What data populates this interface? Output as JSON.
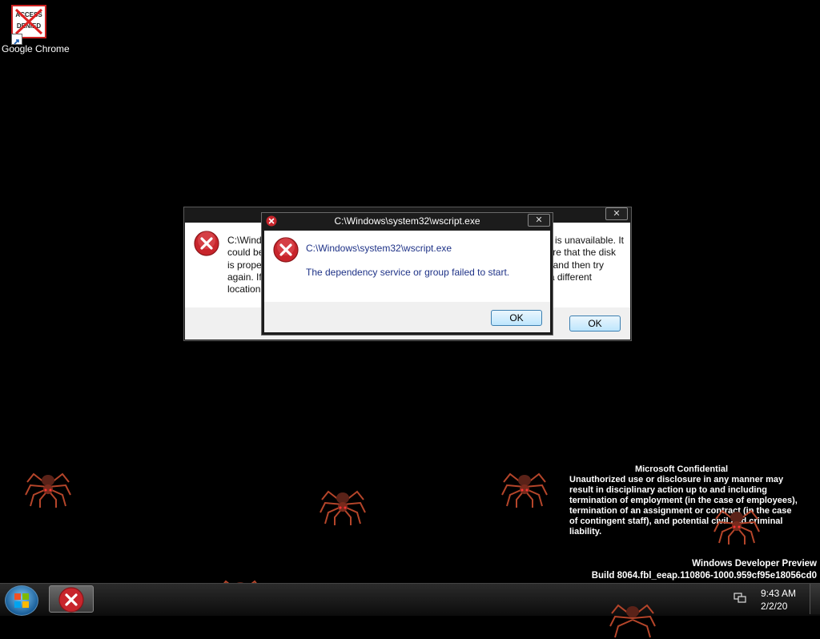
{
  "desktop": {
    "icon_badge_line1": "ACCESS",
    "icon_badge_line2": "DENIED",
    "icon_label": "Google Chrome"
  },
  "dialog_back": {
    "close_symbol": "✕",
    "message_lines": [
      "C:\\Wind",
      "could be",
      "is prope",
      "again. If",
      "location"
    ],
    "message_lines_right": [
      "is unavailable. It",
      "ure that the disk",
      " and then try",
      "a different",
      ""
    ],
    "ok_label": "OK"
  },
  "dialog_front": {
    "title": "C:\\Windows\\system32\\wscript.exe",
    "close_symbol": "✕",
    "path_line": "C:\\Windows\\system32\\wscript.exe",
    "message": "The dependency service or group failed to start.",
    "ok_label": "OK"
  },
  "watermark": {
    "title": "Microsoft Confidential",
    "lines": [
      "Unauthorized use or disclosure in any manner may",
      "result in disciplinary action up to and including",
      "termination of employment (in the case of employees),",
      "termination of an assignment or contract (in the case",
      "of contingent staff), and potential civil and criminal",
      "liability."
    ],
    "preview_line1": "Windows Developer Preview",
    "preview_line2": "Build 8064.fbl_eeap.110806-1000.959cf95e18056cd0"
  },
  "taskbar": {
    "time": "9:43 AM",
    "date": "2/2/20"
  },
  "icons": {
    "error": "error-x-icon",
    "start": "windows-start-icon",
    "network": "network-icon",
    "spider": "spider-icon"
  },
  "colors": {
    "desktop_bg": "#000000",
    "error_red": "#c8252c",
    "ok_border": "#3c7fb1",
    "front_text": "#1e3287"
  }
}
